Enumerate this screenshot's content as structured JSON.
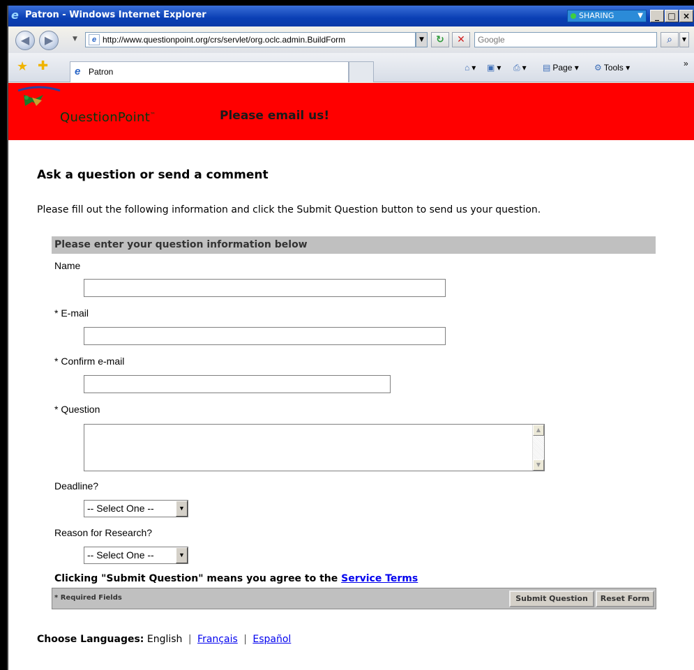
{
  "window": {
    "title": "Patron - Windows Internet Explorer",
    "sharing_label": "SHARING"
  },
  "nav": {
    "address": "http://www.questionpoint.org/crs/servlet/org.oclc.admin.BuildForm",
    "search_placeholder": "Google"
  },
  "tabs": {
    "active_label": "Patron",
    "commands": {
      "page": "Page",
      "tools": "Tools"
    }
  },
  "banner": {
    "logo_text": "QuestionPoint",
    "logo_tm": "™",
    "title": "Please email us!",
    "bg_color": "#ff0000"
  },
  "page": {
    "heading": "Ask a question or send a comment",
    "intro": "Please fill out the following information and click the Submit Question button to send us your question."
  },
  "form": {
    "header": "Please enter your question information below",
    "name_label": "Name",
    "email_label": "* E-mail",
    "confirm_email_label": "* Confirm e-mail",
    "question_label": "* Question",
    "deadline_label": "Deadline?",
    "deadline_value": "-- Select One --",
    "reason_label": "Reason for Research?",
    "reason_value": "-- Select One --",
    "agree_text": "Clicking \"Submit Question\" means you agree to the ",
    "service_terms": "Service Terms",
    "required_note": "* Required Fields",
    "submit_label": "Submit Question",
    "reset_label": "Reset Form"
  },
  "languages": {
    "label": "Choose Languages:",
    "current": "English",
    "french": "Français",
    "spanish": "Español"
  }
}
